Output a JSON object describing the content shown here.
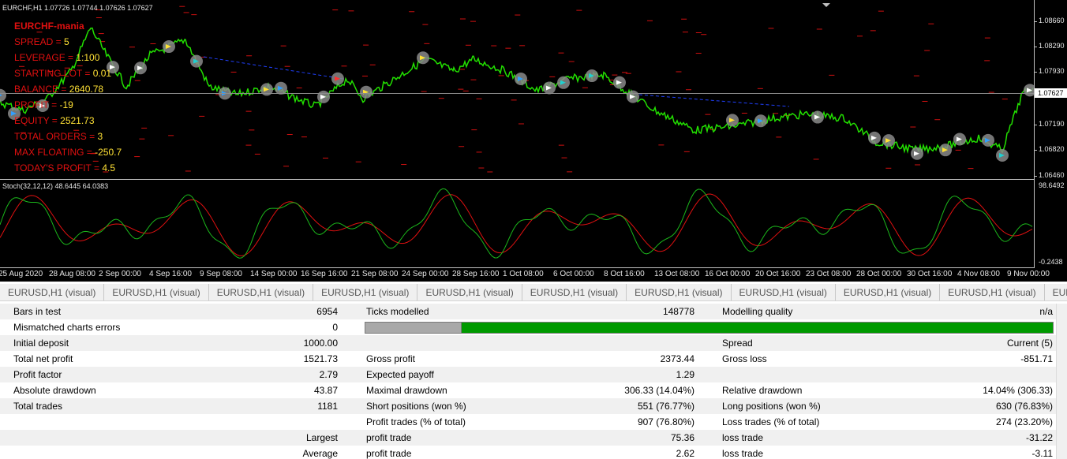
{
  "chart": {
    "symbol_caption": "EURCHF,H1  1.07726 1.07744 1.07626 1.07627",
    "indicator_caption": "Stoch(32,12,12) 48.6445 64.0383",
    "price_axis": [
      "1.08660",
      "1.08290",
      "1.07930",
      "1.07190",
      "1.06820",
      "1.06460"
    ],
    "current_price": "1.07627",
    "stoch_axis_top": "98.6492",
    "stoch_axis_bottom": "-0.2438",
    "time_axis": [
      "25 Aug 2020",
      "28 Aug 08:00",
      "2 Sep 00:00",
      "4 Sep 16:00",
      "9 Sep 08:00",
      "14 Sep 00:00",
      "16 Sep 16:00",
      "21 Sep 08:00",
      "24 Sep 00:00",
      "28 Sep 16:00",
      "1 Oct 08:00",
      "6 Oct 00:00",
      "8 Oct 16:00",
      "13 Oct 08:00",
      "16 Oct 00:00",
      "20 Oct 16:00",
      "23 Oct 08:00",
      "28 Oct 00:00",
      "30 Oct 16:00",
      "4 Nov 08:00",
      "9 Nov 00:00"
    ],
    "colors": {
      "background": "#000000",
      "price_line": "#22e000",
      "label_red": "#e01010",
      "label_value": "#ffe135",
      "stoch_main": "#1bb81b",
      "stoch_signal": "#e01010"
    }
  },
  "ea_panel": {
    "name": "EURCHF-mania",
    "lines": [
      {
        "label": "SPREAD = ",
        "value": "5"
      },
      {
        "label": "LEVERAGE = ",
        "value": "1:100"
      },
      {
        "label": "STARTING LOT = ",
        "value": "0.01"
      },
      {
        "label": "BALANCE = ",
        "value": "2640.78"
      },
      {
        "label": "PROFIT = ",
        "value": "-19"
      },
      {
        "label": "EQUITY = ",
        "value": "2521.73"
      },
      {
        "label": "TOTAL ORDERS = ",
        "value": "3"
      },
      {
        "label": "MAX FLOATING = ",
        "value": "-250.7"
      },
      {
        "label": "TODAY'S PROFIT = ",
        "value": "4.5"
      }
    ]
  },
  "tabs": [
    "EURUSD,H1 (visual)",
    "EURUSD,H1 (visual)",
    "EURUSD,H1 (visual)",
    "EURUSD,H1 (visual)",
    "EURUSD,H1 (visual)",
    "EURUSD,H1 (visual)",
    "EURUSD,H1 (visual)",
    "EURUSD,H1 (visual)",
    "EURUSD,H1 (visual)",
    "EURUSD,H1 (visual)",
    "EURUSD,H1 (v"
  ],
  "report": {
    "modelling_quality_fraction": 0.14,
    "rows": [
      {
        "c1": "Bars in test",
        "c2": "6954",
        "c3": "Ticks modelled",
        "c4": "148778",
        "c5": "Modelling quality",
        "c6": "n/a"
      },
      {
        "c1": "Mismatched charts errors",
        "c2": "0",
        "c3": "",
        "c4": "",
        "c5": "",
        "c6": ""
      },
      {
        "c1": "Initial deposit",
        "c2": "1000.00",
        "c3": "",
        "c4": "",
        "c5": "Spread",
        "c6": "Current (5)"
      },
      {
        "c1": "Total net profit",
        "c2": "1521.73",
        "c3": "Gross profit",
        "c4": "2373.44",
        "c5": "Gross loss",
        "c6": "-851.71"
      },
      {
        "c1": "Profit factor",
        "c2": "2.79",
        "c3": "Expected payoff",
        "c4": "1.29",
        "c5": "",
        "c6": ""
      },
      {
        "c1": "Absolute drawdown",
        "c2": "43.87",
        "c3": "Maximal drawdown",
        "c4": "306.33 (14.04%)",
        "c5": "Relative drawdown",
        "c6": "14.04% (306.33)"
      },
      {
        "c1": "Total trades",
        "c2": "1181",
        "c3": "Short positions (won %)",
        "c4": "551 (76.77%)",
        "c5": "Long positions (won %)",
        "c6": "630 (76.83%)"
      },
      {
        "c1": "",
        "c2": "",
        "c3": "Profit trades (% of total)",
        "c4": "907 (76.80%)",
        "c5": "Loss trades (% of total)",
        "c6": "274 (23.20%)"
      },
      {
        "c1": "",
        "c2": "Largest",
        "c3": "profit trade",
        "c4": "75.36",
        "c5": "loss trade",
        "c6": "-31.22"
      },
      {
        "c1": "",
        "c2": "Average",
        "c3": "profit trade",
        "c4": "2.62",
        "c5": "loss trade",
        "c6": "-3.11"
      }
    ]
  }
}
